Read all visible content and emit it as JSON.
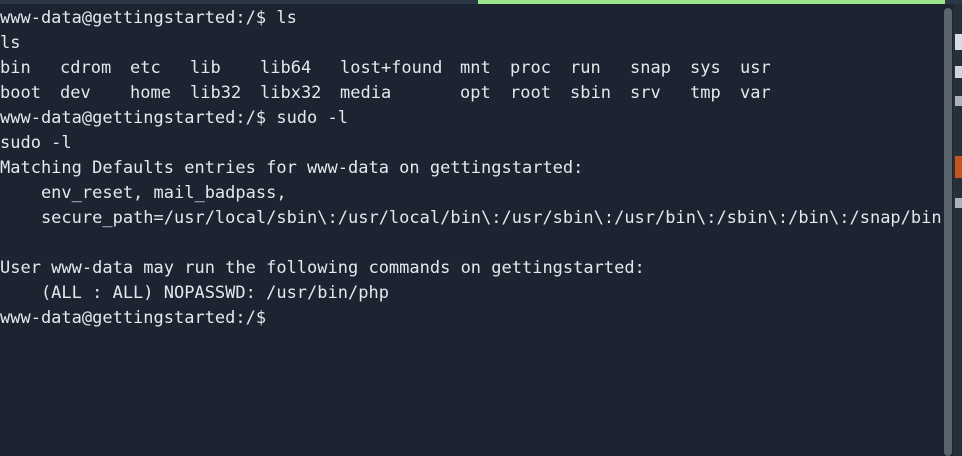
{
  "terminal": {
    "lines": [
      "www-data@gettingstarted:/$ ls",
      "ls",
      "",
      "",
      "www-data@gettingstarted:/$ sudo -l",
      "sudo -l",
      "Matching Defaults entries for www-data on gettingstarted:",
      "    env_reset, mail_badpass,",
      "    secure_path=/usr/local/sbin\\:/usr/local/bin\\:/usr/sbin\\:/usr/bin\\:/sbin\\:/bin\\:/snap/bin",
      "",
      "User www-data may run the following commands on gettingstarted:",
      "    (ALL : ALL) NOPASSWD: /usr/bin/php",
      "www-data@gettingstarted:/$"
    ],
    "ls_row1": [
      "bin",
      "cdrom",
      "etc",
      "lib",
      "lib64",
      "lost+found",
      "mnt",
      "proc",
      "run",
      "snap",
      "sys",
      "usr"
    ],
    "ls_row2": [
      "boot",
      "dev",
      "home",
      "lib32",
      "libx32",
      "media",
      "opt",
      "root",
      "sbin",
      "srv",
      "tmp",
      "var"
    ]
  },
  "colors": {
    "background": "#1b2430",
    "foreground": "#e4e8ec",
    "active_indicator": "#9ae88a"
  }
}
